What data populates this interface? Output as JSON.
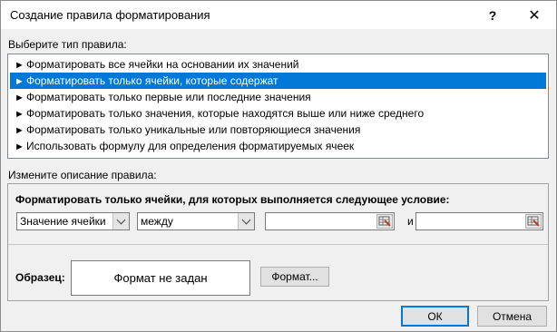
{
  "window": {
    "title": "Создание правила форматирования",
    "help_label": "?",
    "close_label": "✕"
  },
  "rule_type": {
    "label": "Выберите тип правила:",
    "items": [
      {
        "label": "Форматировать все ячейки на основании их значений",
        "selected": false
      },
      {
        "label": "Форматировать только ячейки, которые содержат",
        "selected": true
      },
      {
        "label": "Форматировать только первые или последние значения",
        "selected": false
      },
      {
        "label": "Форматировать только значения, которые находятся выше или ниже среднего",
        "selected": false
      },
      {
        "label": "Форматировать только уникальные или повторяющиеся значения",
        "selected": false
      },
      {
        "label": "Использовать формулу для определения форматируемых ячеек",
        "selected": false
      }
    ],
    "bullet": "►"
  },
  "description": {
    "label": "Измените описание правила:",
    "heading": "Форматировать только ячейки, для которых выполняется следующее условие:",
    "condition_combo": "Значение ячейки",
    "operator_combo": "между",
    "value1": "",
    "and_label": "и",
    "value2": "",
    "sample_label": "Образец:",
    "sample_text": "Формат не задан",
    "format_button": "Формат..."
  },
  "footer": {
    "ok": "ОК",
    "cancel": "Отмена"
  },
  "colors": {
    "selection": "#0078d7",
    "default_button_border": "#0078d7"
  }
}
